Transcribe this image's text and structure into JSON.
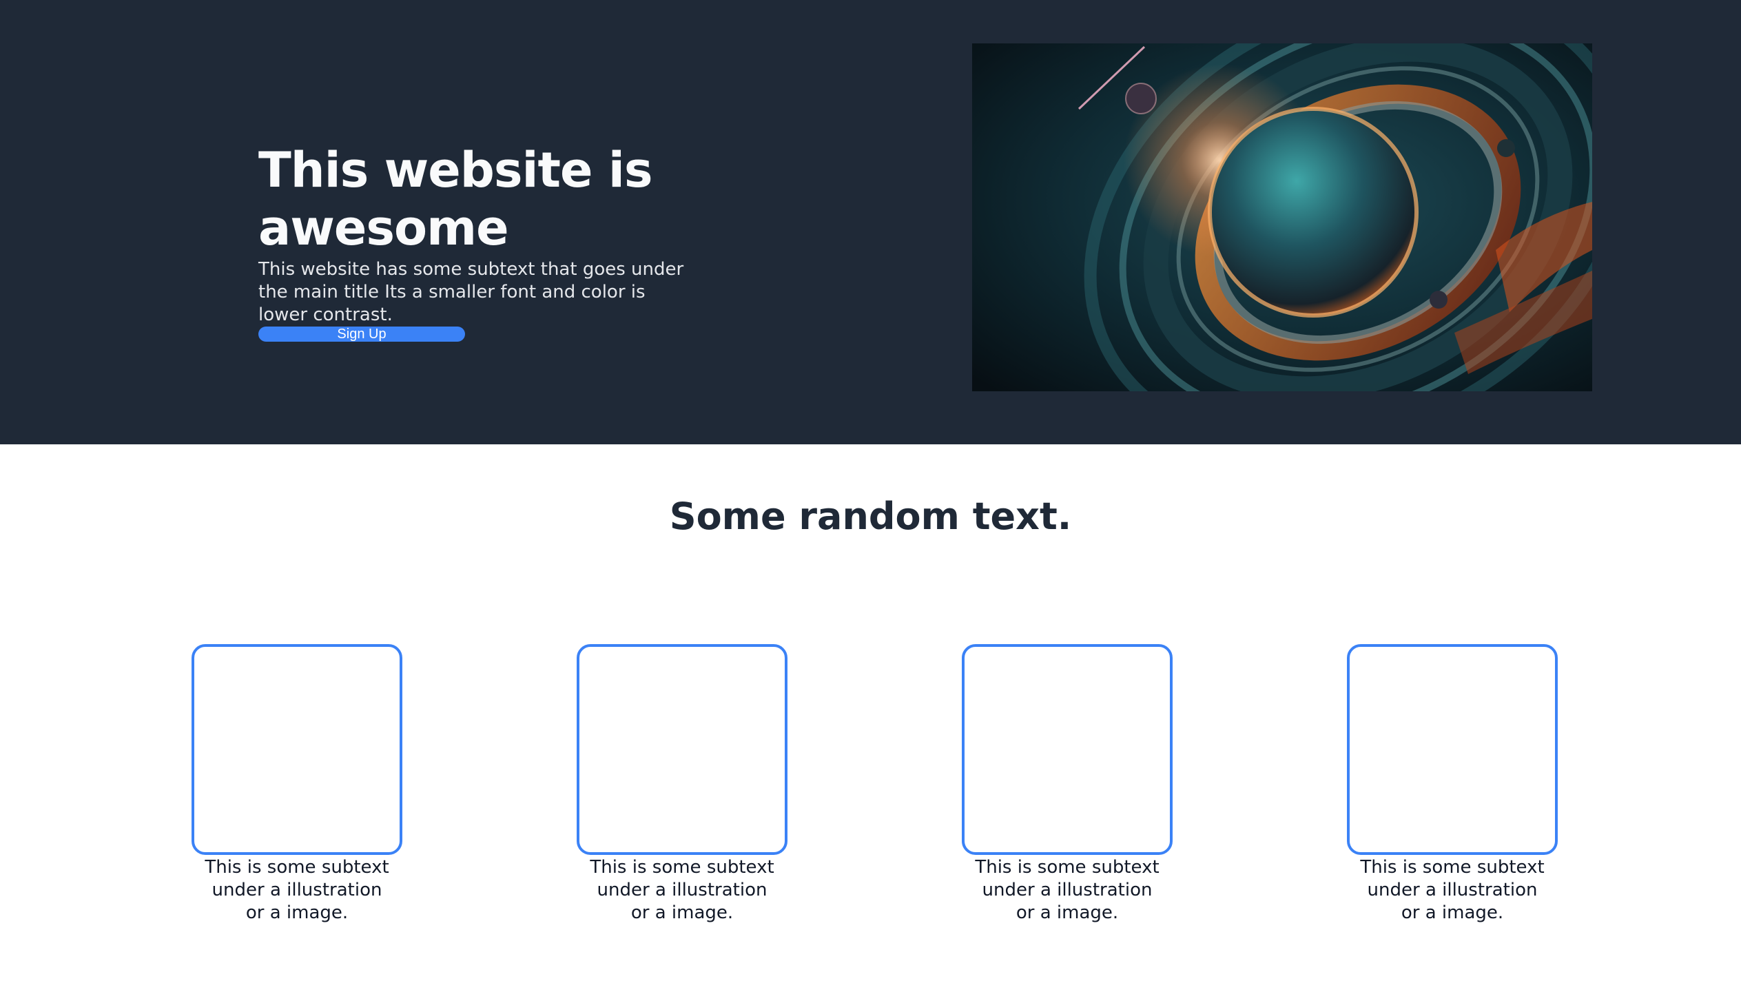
{
  "hero": {
    "title": "This website is awesome",
    "subtext": "This website has some subtext that goes under the main title Its a smaller font and color is lower contrast.",
    "signup_label": "Sign Up",
    "background_color": "#1f2937",
    "button_color": "#3b82f6",
    "image_icon": "space-planet-illustration"
  },
  "info": {
    "heading": "Some random text.",
    "accent_color": "#3b82f6",
    "cards": [
      {
        "caption": "This is some subtext under a illustration or a image."
      },
      {
        "caption": "This is some subtext under a illustration or a image."
      },
      {
        "caption": "This is some subtext under a illustration or a image."
      },
      {
        "caption": "This is some subtext under a illustration or a image."
      }
    ]
  }
}
